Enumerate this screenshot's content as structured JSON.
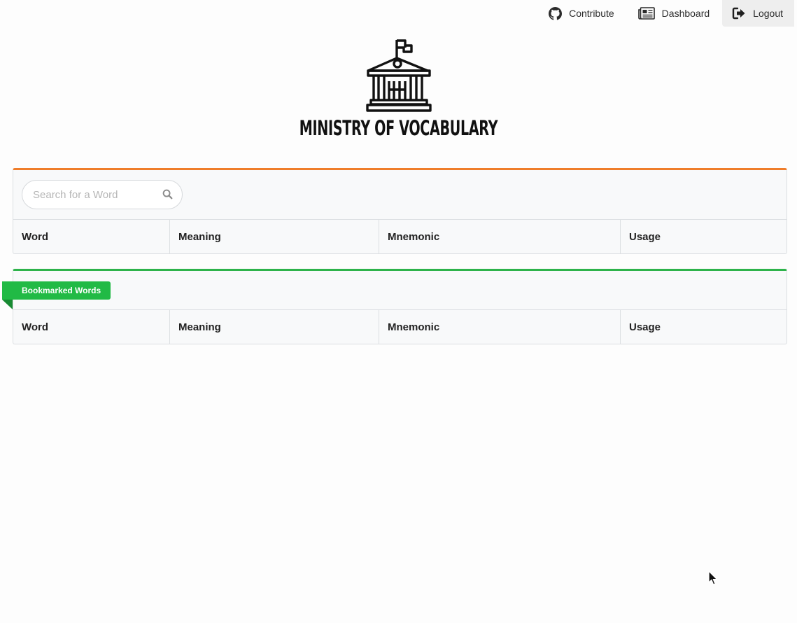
{
  "nav": {
    "contribute": {
      "label": "Contribute",
      "icon": "github-icon"
    },
    "dashboard": {
      "label": "Dashboard",
      "icon": "newspaper-icon"
    },
    "logout": {
      "label": "Logout",
      "icon": "sign-out-icon"
    }
  },
  "logo": {
    "text": "MINISTRY OF VOCABULARY",
    "icon": "government-building-icon"
  },
  "search": {
    "placeholder": "Search for a Word",
    "value": "",
    "icon": "search-icon",
    "accent_color": "#ef7d2b"
  },
  "words_table": {
    "columns": [
      "Word",
      "Meaning",
      "Mnemonic",
      "Usage"
    ],
    "rows": []
  },
  "bookmarks": {
    "ribbon_label": "Bookmarked Words",
    "accent_color": "#2eb34b",
    "columns": [
      "Word",
      "Meaning",
      "Mnemonic",
      "Usage"
    ],
    "rows": []
  }
}
